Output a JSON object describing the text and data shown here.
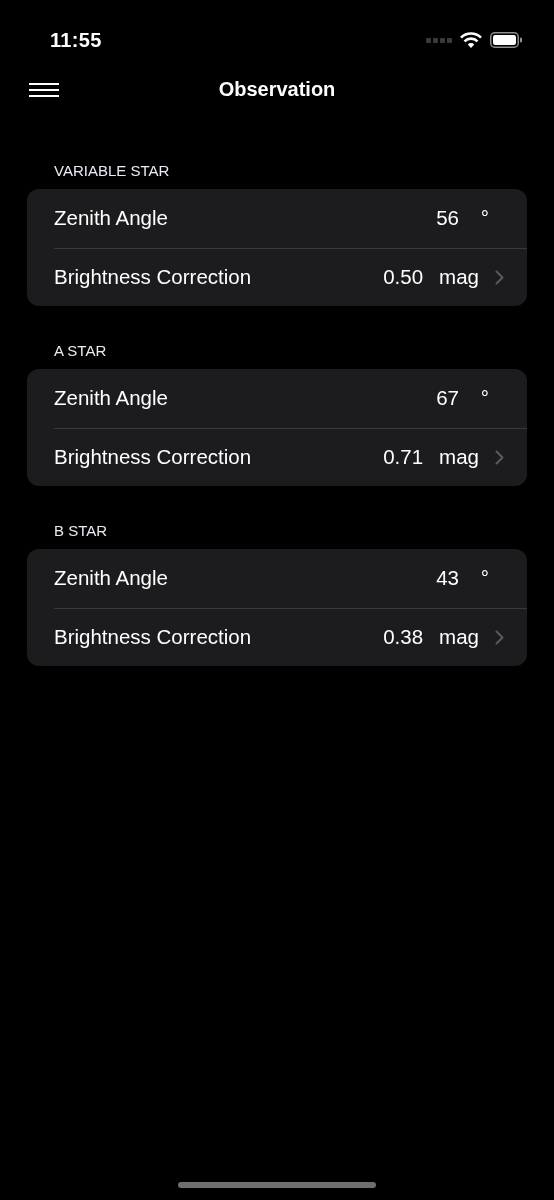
{
  "status_bar": {
    "time": "11:55"
  },
  "nav": {
    "title": "Observation"
  },
  "sections": [
    {
      "header": "VARIABLE STAR",
      "rows": [
        {
          "kind": "value",
          "label": "Zenith Angle",
          "value": "56",
          "unit": "°"
        },
        {
          "kind": "disclosure",
          "label": "Brightness Correction",
          "value": "0.50",
          "unit": "mag"
        }
      ]
    },
    {
      "header": "A STAR",
      "rows": [
        {
          "kind": "value",
          "label": "Zenith Angle",
          "value": "67",
          "unit": "°"
        },
        {
          "kind": "disclosure",
          "label": "Brightness Correction",
          "value": "0.71",
          "unit": "mag"
        }
      ]
    },
    {
      "header": "B STAR",
      "rows": [
        {
          "kind": "value",
          "label": "Zenith Angle",
          "value": "43",
          "unit": "°"
        },
        {
          "kind": "disclosure",
          "label": "Brightness Correction",
          "value": "0.38",
          "unit": "mag"
        }
      ]
    }
  ]
}
